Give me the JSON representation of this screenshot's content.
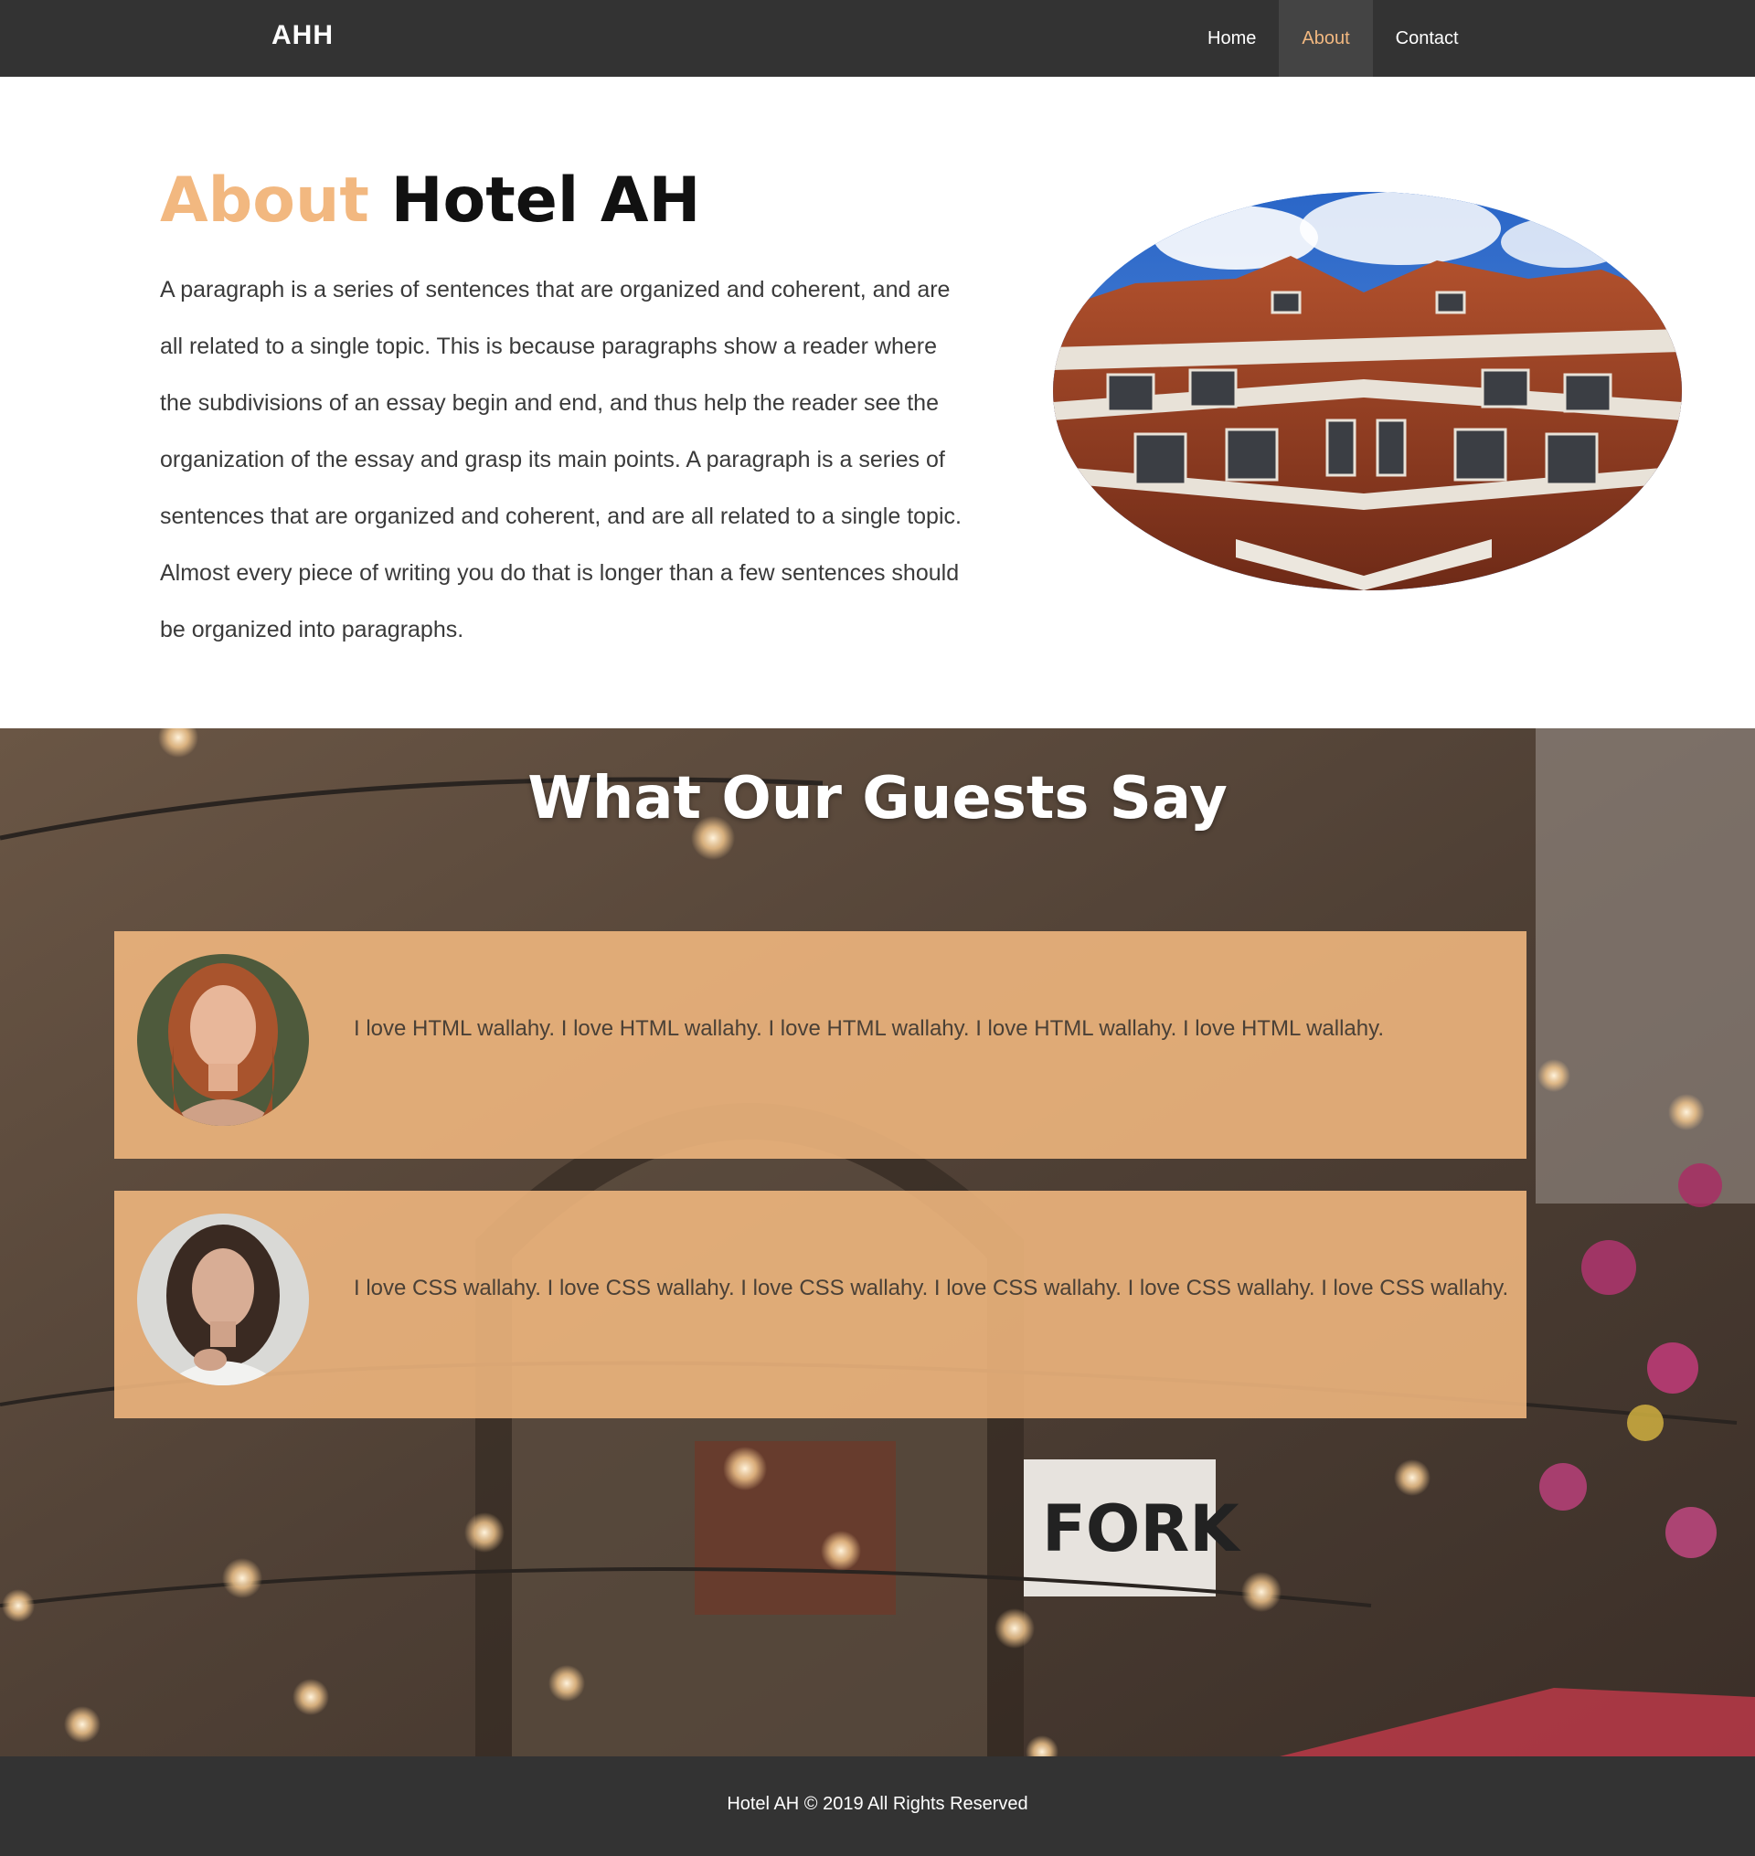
{
  "navbar": {
    "brand": "AHH",
    "items": [
      {
        "label": "Home",
        "active": false
      },
      {
        "label": "About",
        "active": true
      },
      {
        "label": "Contact",
        "active": false
      }
    ]
  },
  "about": {
    "title_accent": "About",
    "title_rest": "Hotel AH",
    "paragraph": "A paragraph is a series of sentences that are organized and coherent, and are all related to a single topic. This is because paragraphs show a reader where the subdivisions of an essay begin and end, and thus help the reader see the organization of the essay and grasp its main points. A paragraph is a series of sentences that are organized and coherent, and are all related to a single topic. Almost every piece of writing you do that is longer than a few sentences should be organized into paragraphs."
  },
  "testimonials": {
    "title": "What Our Guests Say",
    "items": [
      {
        "quote": "I love HTML wallahy. I love HTML wallahy. I love HTML wallahy. I love HTML wallahy. I love HTML wallahy."
      },
      {
        "quote": "I love CSS wallahy. I love CSS wallahy. I love CSS wallahy. I love CSS wallahy. I love CSS wallahy. I love CSS wallahy."
      }
    ]
  },
  "footer": {
    "text": "Hotel AH © 2019 All Rights Reserved"
  },
  "colors": {
    "nav_bg": "#333333",
    "accent": "#f2b880",
    "card_bg": "#f2b880",
    "footer_bg": "#333333"
  }
}
